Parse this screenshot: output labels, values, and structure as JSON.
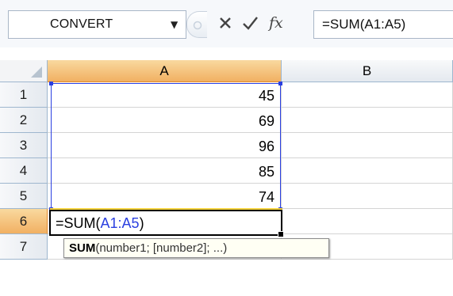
{
  "formula_bar": {
    "name_box": "CONVERT",
    "cancel_icon": "close-icon",
    "enter_icon": "checkmark-icon",
    "insert_function_label": "fx",
    "formula": "=SUM(A1:A5)"
  },
  "columns": [
    "A",
    "B"
  ],
  "rows": [
    {
      "num": "1",
      "a": "45",
      "b": ""
    },
    {
      "num": "2",
      "a": "69",
      "b": ""
    },
    {
      "num": "3",
      "a": "96",
      "b": ""
    },
    {
      "num": "4",
      "a": "85",
      "b": ""
    },
    {
      "num": "5",
      "a": "74",
      "b": ""
    },
    {
      "num": "6",
      "a": "",
      "b": ""
    },
    {
      "num": "7",
      "a": "",
      "b": ""
    }
  ],
  "active_cell": {
    "prefix": "=SUM(",
    "range": "A1:A5",
    "suffix": ")"
  },
  "tooltip": {
    "function_name": "SUM",
    "args": "(number1; [number2]; ...)"
  },
  "colors": {
    "range_highlight": "#2a3fe0",
    "selected_header": "#f1b062"
  }
}
